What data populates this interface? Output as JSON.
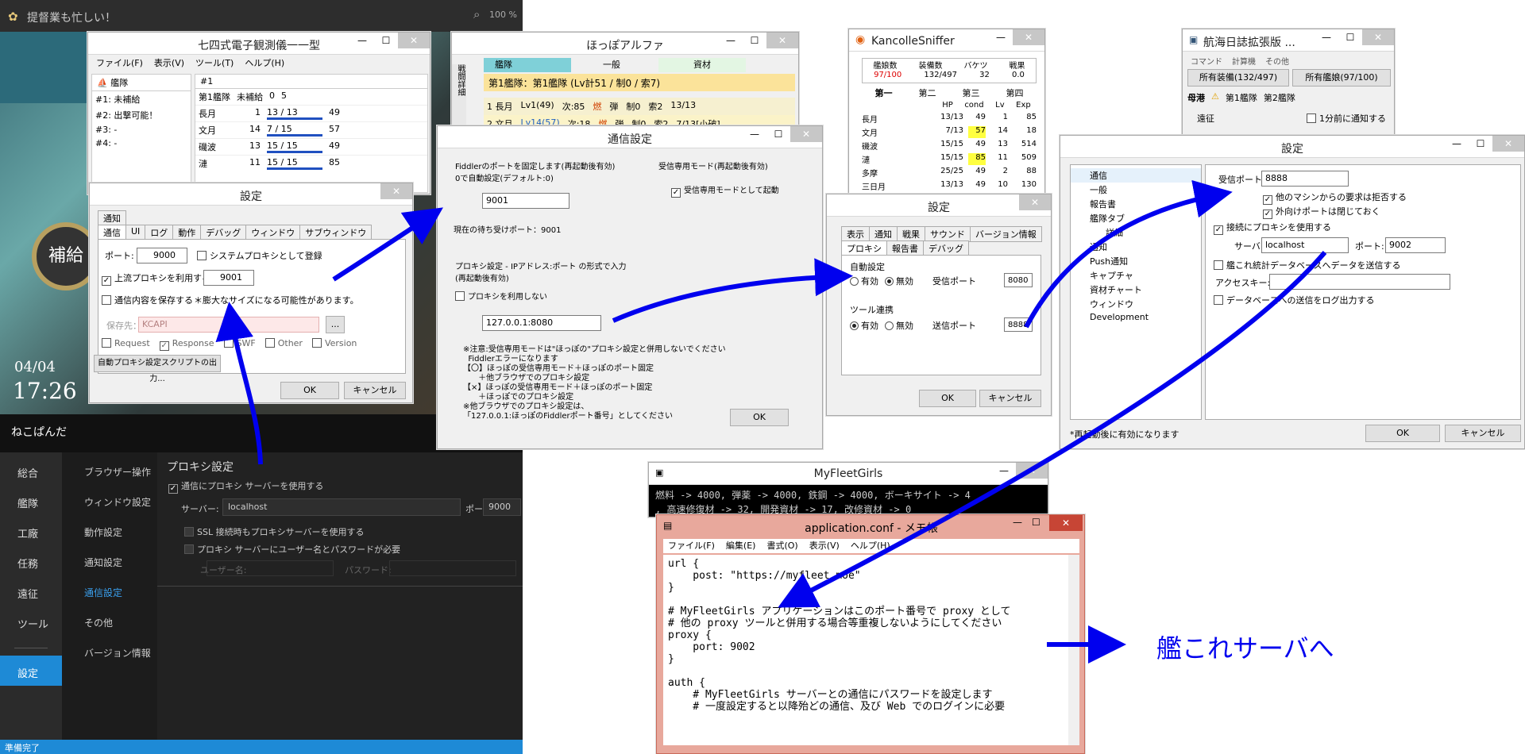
{
  "main": {
    "title": "提督業も忙しい！",
    "zoom": "100 %",
    "date": "04/04",
    "time": "17:26",
    "ship_name": "ねこぱんだ",
    "side_label": "補給",
    "nav": [
      "総合",
      "艦隊",
      "工廠",
      "任務",
      "遠征",
      "ツール",
      "設定"
    ],
    "subnav": [
      "ブラウザー操作",
      "ウィンドウ設定",
      "動作設定",
      "通知設定",
      "通信設定",
      "その他",
      "バージョン情報"
    ],
    "proxy_title": "プロキシ設定",
    "use_proxy": "通信にプロキシ サーバーを使用する",
    "server_label": "サーバー:",
    "server_value": "localhost",
    "port_label": "ポート:",
    "port_value": "9000",
    "ssl": "SSL 接続時もプロキシサーバーを使用する",
    "auth": "プロキシ サーバーにユーザー名とパスワードが必要",
    "user_label": "ユーザー名:",
    "pass_label": "パスワード:",
    "status": "準備完了"
  },
  "eo": {
    "title": "七四式電子観測儀一一型",
    "menu": [
      "ファイル(F)",
      "表示(V)",
      "ツール(T)",
      "ヘルプ(H)"
    ],
    "tab1": "艦隊",
    "tab2": "#1",
    "fleets": [
      {
        "id": "#1:",
        "text": "未補給"
      },
      {
        "id": "#2:",
        "text": "出撃可能！"
      },
      {
        "id": "#3:",
        "text": "-"
      },
      {
        "id": "#4:",
        "text": "-"
      }
    ],
    "fleet_head": [
      "第1艦隊",
      "未補給",
      "0",
      "5"
    ],
    "ships": [
      {
        "name": "長月",
        "lv": "1",
        "hp": "13 / 13",
        "cond": "49"
      },
      {
        "name": "文月",
        "lv": "14",
        "hp": "7 / 15",
        "cond": "57"
      },
      {
        "name": "磯波",
        "lv": "13",
        "hp": "15 / 15",
        "cond": "49"
      },
      {
        "name": "漣",
        "lv": "11",
        "hp": "15 / 15",
        "cond": "85"
      }
    ]
  },
  "eo_settings": {
    "title": "設定",
    "tabs1": [
      "通知"
    ],
    "tabs2": [
      "通信",
      "UI",
      "ログ",
      "動作",
      "デバッグ",
      "ウィンドウ",
      "サブウィンドウ"
    ],
    "port_label": "ポート:",
    "port": "9000",
    "system_proxy": "システムプロキシとして登録",
    "upstream": "上流プロキシを利用する：",
    "upstream_port": "9001",
    "save": "通信内容を保存する",
    "note": "＊膨大なサイズになる可能性があります。",
    "save_to": "保存先：",
    "save_path": "KCAPI",
    "browse": "...",
    "types": [
      "Request",
      "Response",
      "SWF",
      "Other",
      "Version"
    ],
    "script": "自動プロキシ設定スクリプトの出力...",
    "ok": "OK",
    "cancel": "キャンセル"
  },
  "hoppo": {
    "title": "ほっぽアルファ",
    "tabs": [
      "艦隊",
      "一般",
      "資材"
    ],
    "side": "戦闘詳細",
    "fleet": "第1艦隊：第1艦隊 (Lv計51 / 制0 / 索7)",
    "rows": [
      [
        "1 長月",
        "Lv1(49)",
        "次:85",
        "燃",
        "弾",
        "制0",
        "索2",
        "13/13"
      ],
      [
        "2 文月",
        "Lv14(57)",
        "次:18",
        "燃",
        "弾",
        "制0",
        "索2",
        "7/13[小破]"
      ]
    ]
  },
  "hoppo_settings": {
    "title": "通信設定",
    "fiddler": "Fiddlerのポートを固定します(再起動後有効)\n0で自動設定(デフォルト:0)",
    "fiddler_port": "9001",
    "current": "現在の待ち受けポート：9001",
    "recv_title": "受信専用モード(再起動後有効)",
    "recv": "受信専用モードとして起動",
    "proxy_title": "プロキシ設定 - IPアドレス:ポート の形式で入力\n(再起動後有効)",
    "no_proxy": "プロキシを利用しない",
    "proxy_value": "127.0.0.1:8080",
    "notes": "※注意:受信専用モードは\"ほっぽの\"プロキシ設定と併用しないでください\n  Fiddlerエラーになります\n【〇】ほっぽの受信専用モード＋ほっぽのポート固定\n      ＋他ブラウザでのプロキシ設定\n【×】ほっぽの受信専用モード＋ほっぽのポート固定\n      ＋ほっぽでのプロキシ設定\n※他ブラウザでのプロキシ設定は、\n「127.0.0.1:ほっぽのFiddlerポート番号」としてください",
    "ok": "OK"
  },
  "sniffer": {
    "title": "KancolleSniffer",
    "head": [
      "艦娘数",
      "装備数",
      "バケツ",
      "戦果"
    ],
    "vals": [
      "97/100",
      "132/497",
      "32",
      "0.0"
    ],
    "tabs": [
      "第一",
      "第二",
      "第三",
      "第四"
    ],
    "cols": [
      "HP",
      "cond",
      "Lv",
      "Exp"
    ],
    "rows": [
      [
        "長月",
        "13/13",
        "49",
        "1",
        "85"
      ],
      [
        "文月",
        "7/13",
        "57",
        "14",
        "18"
      ],
      [
        "磯波",
        "15/15",
        "49",
        "13",
        "514"
      ],
      [
        "漣",
        "15/15",
        "85",
        "11",
        "509"
      ],
      [
        "多摩",
        "25/25",
        "49",
        "2",
        "88"
      ],
      [
        "三日月",
        "13/13",
        "49",
        "10",
        "130"
      ]
    ]
  },
  "sniffer_settings": {
    "title": "設定",
    "tabs1": [
      "表示",
      "通知",
      "戦果",
      "サウンド",
      "バージョン情報"
    ],
    "tabs2": [
      "プロキシ",
      "報告書",
      "デバッグ"
    ],
    "auto": "自動設定",
    "on": "有効",
    "off": "無効",
    "recv_port": "受信ポート",
    "recv_port_val": "8080",
    "tool": "ツール連携",
    "send_port": "送信ポート",
    "send_port_val": "8888",
    "ok": "OK",
    "cancel": "キャンセル"
  },
  "logbook": {
    "title": "航海日誌拡張版 ...",
    "menu": [
      "コマンド",
      "計算機",
      "その他"
    ],
    "btn1": "所有装備(132/497)",
    "btn2": "所有艦娘(97/100)",
    "tabs": [
      "母港",
      "第1艦隊",
      "第2艦隊"
    ],
    "exp": "遠征",
    "notify": "1分前に通知する"
  },
  "logbook_settings": {
    "title": "設定",
    "tree": [
      "通信",
      "一般",
      "報告書",
      "艦隊タブ",
      "詳細",
      "通知",
      "Push通知",
      "キャプチャ",
      "資材チャート",
      "ウィンドウ",
      "Development"
    ],
    "recv_port_label": "受信ポート",
    "recv_port": "8888",
    "reject": "他のマシンからの要求は拒否する",
    "close_ext": "外向けポートは閉じておく",
    "use_proxy": "接続にプロキシを使用する",
    "server_label": "サーバ:",
    "server": "localhost",
    "port_label": "ポート:",
    "port": "9002",
    "send_db": "艦これ統計データベースへデータを送信する",
    "access_key": "アクセスキー:",
    "log_db": "データベースへの送信をログ出力する",
    "footer": "*再起動後に有効になります",
    "ok": "OK",
    "cancel": "キャンセル"
  },
  "mfg": {
    "title": "MyFleetGirls",
    "line1": "燃料 -> 4000, 弾薬 -> 4000, 鉄鋼 -> 4000, ボーキサイト -> 4",
    "line2": ", 高速修復材 -> 32, 開発資材 -> 17, 改修資材 -> 0"
  },
  "notepad": {
    "title": "application.conf - メモ帳",
    "menu": [
      "ファイル(F)",
      "編集(E)",
      "書式(O)",
      "表示(V)",
      "ヘルプ(H)"
    ],
    "lines": [
      "url {",
      "    post: \"https://myfleet.moe\"",
      "}",
      "",
      "# MyFleetGirls アプリケーションはこのポート番号で proxy として",
      "# 他の proxy ツールと併用する場合等重複しないようにしてください",
      "proxy {",
      "    port: 9002",
      "}",
      "",
      "auth {",
      "    # MyFleetGirls サーバーとの通信にパスワードを設定します",
      "    # 一度設定すると以降殆どの通信、及び Web でのログインに必要"
    ]
  },
  "annotation": "艦これサーバへ",
  "colors": {
    "arrow": "#0000ee",
    "accent": "#1e8ad6",
    "dark": "#2b2b2b"
  }
}
